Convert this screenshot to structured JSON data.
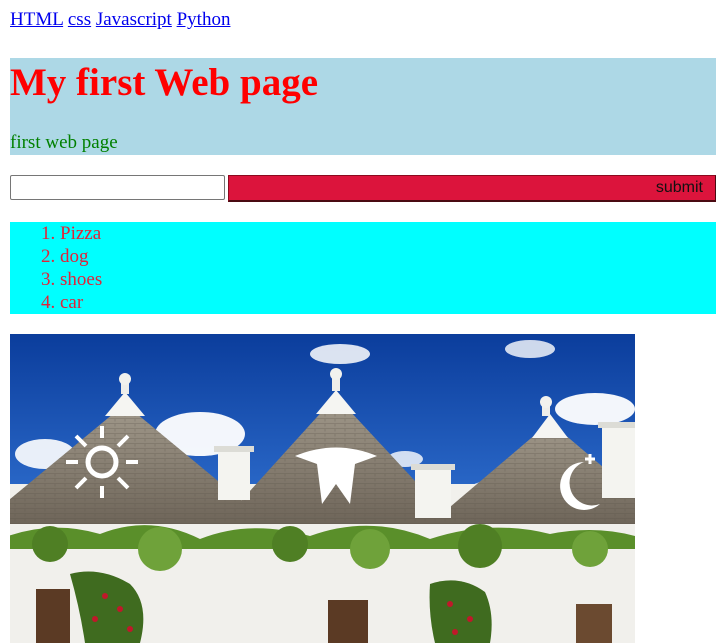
{
  "nav": {
    "links": [
      "HTML",
      "css",
      "Javascript",
      "Python"
    ]
  },
  "header": {
    "title": "My first Web page",
    "subtitle": "first web page",
    "background": "#add8e6",
    "title_color": "#ff0000",
    "subtitle_color": "#008000"
  },
  "form": {
    "input_value": "",
    "submit_label": "submit",
    "submit_color": "#dc143c"
  },
  "list": {
    "background": "#00ffff",
    "item_color": "#e0243a",
    "items": [
      "Pizza",
      "dog",
      "shoes",
      "car"
    ]
  },
  "photo": {
    "subject": "trulli-houses-image"
  }
}
